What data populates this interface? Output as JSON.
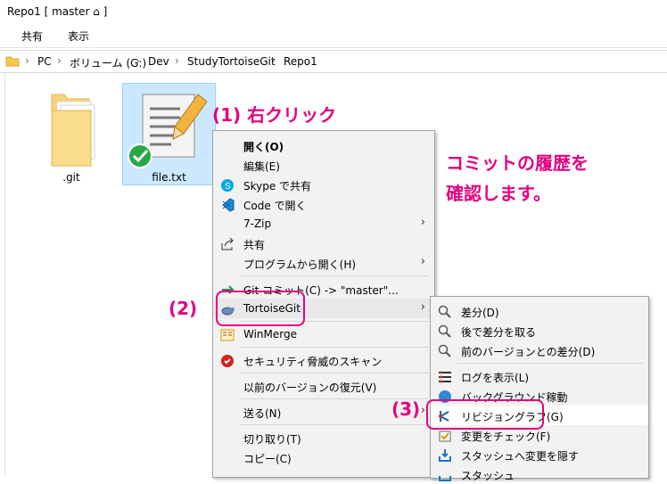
{
  "window": {
    "title": "Repo1 [ master ⌂ ]"
  },
  "ribbon": {
    "tabs": [
      "共有",
      "表示"
    ]
  },
  "address": {
    "crumbs": [
      "PC",
      "ボリューム (G:)",
      "Dev",
      "StudyTortoiseGit",
      "Repo1"
    ]
  },
  "files": [
    {
      "name": ".git"
    },
    {
      "name": "file.txt"
    }
  ],
  "context_menu": {
    "items": [
      {
        "label": "開く(O)"
      },
      {
        "label": "編集(E)"
      },
      {
        "label": "Skype で共有"
      },
      {
        "label": "Code で開く"
      },
      {
        "label": "7-Zip"
      },
      {
        "label": "共有"
      },
      {
        "label": "プログラムから開く(H)"
      },
      {
        "label": "Git コミット(C) -> \"master\"..."
      },
      {
        "label": "TortoiseGit"
      },
      {
        "label": "WinMerge"
      },
      {
        "label": "セキュリティ脅威のスキャン"
      },
      {
        "label": "以前のバージョンの復元(V)"
      },
      {
        "label": "送る(N)"
      },
      {
        "label": "切り取り(T)"
      },
      {
        "label": "コピー(C)"
      }
    ]
  },
  "submenu": {
    "items": [
      {
        "label": "差分(D)"
      },
      {
        "label": "後で差分を取る"
      },
      {
        "label": "前のバージョンとの差分(D)"
      },
      {
        "label": "ログを表示(L)"
      },
      {
        "label": "バックグラウンド稼動"
      },
      {
        "label": "リビジョングラフ(G)"
      },
      {
        "label": "変更をチェック(F)"
      },
      {
        "label": "スタッシュへ変更を隠す"
      },
      {
        "label": "スタッシュ"
      }
    ]
  },
  "annotations": {
    "step1": "(1) 右クリック",
    "step2": "(2)",
    "step3": "(3)",
    "note_line1": "コミットの履歴を",
    "note_line2": "確認します。"
  }
}
